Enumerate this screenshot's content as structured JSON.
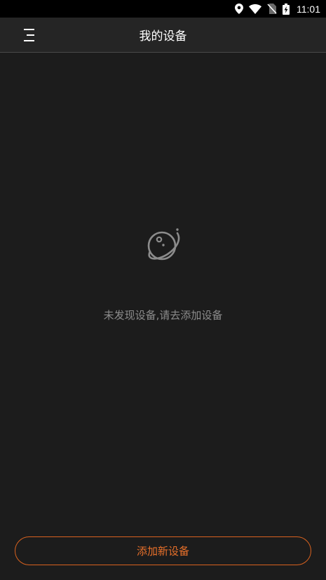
{
  "status_bar": {
    "time": "11:01",
    "icons": [
      "location-icon",
      "wifi-icon",
      "no-sim-icon",
      "battery-charging-icon"
    ]
  },
  "app_bar": {
    "title": "我的设备",
    "menu_icon": "menu-icon"
  },
  "empty_state": {
    "icon": "planet-icon",
    "message": "未发现设备,请去添加设备"
  },
  "footer": {
    "add_button_label": "添加新设备"
  },
  "colors": {
    "background": "#1c1c1c",
    "app_bar": "#252525",
    "accent": "#e8702a",
    "muted_text": "#8c8c8c"
  }
}
